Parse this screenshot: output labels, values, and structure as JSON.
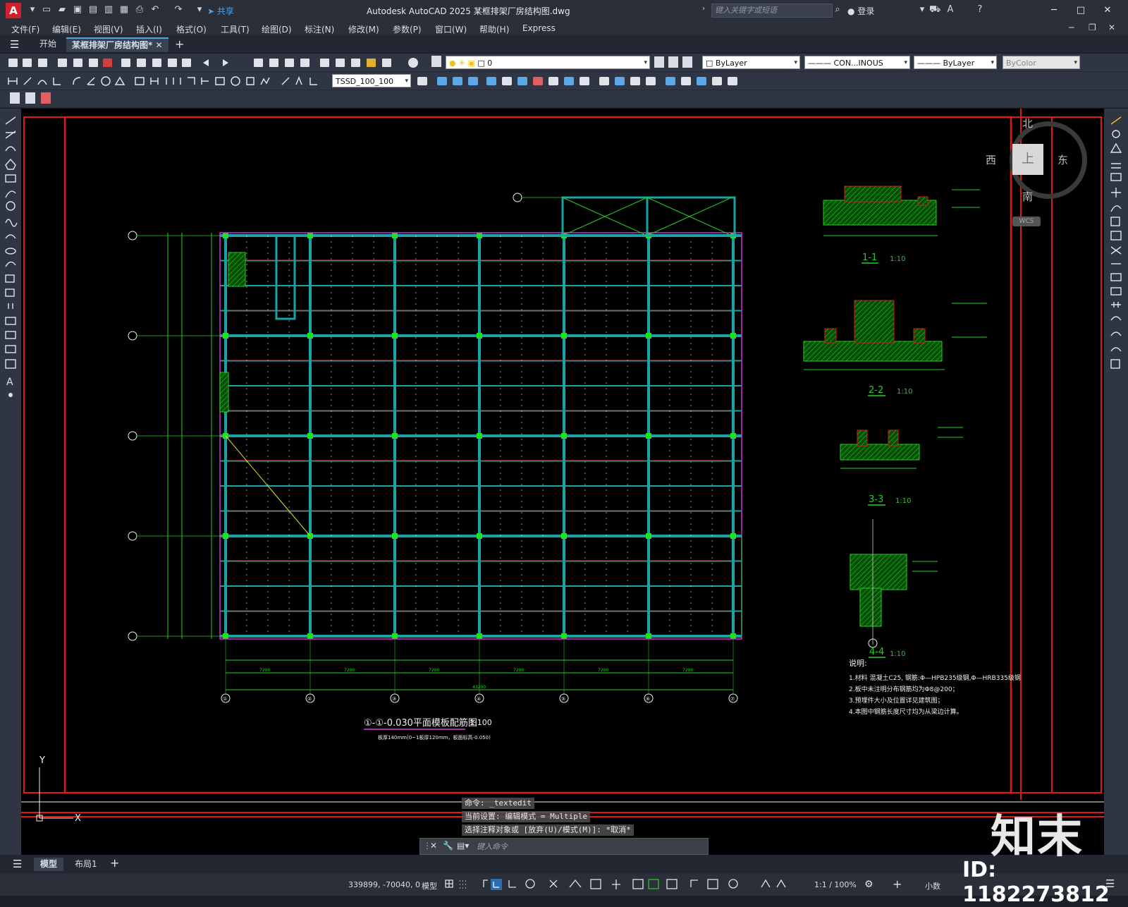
{
  "app": {
    "title": "Autodesk AutoCAD 2025    某框排架厂房结构图.dwg",
    "logo": "A",
    "share_label": "共享",
    "search_placeholder": "键入关键字或短语",
    "login_label": "登录"
  },
  "menu": [
    "文件(F)",
    "编辑(E)",
    "视图(V)",
    "插入(I)",
    "格式(O)",
    "工具(T)",
    "绘图(D)",
    "标注(N)",
    "修改(M)",
    "参数(P)",
    "窗口(W)",
    "帮助(H)",
    "Express"
  ],
  "tabs": {
    "start": "开始",
    "active": "某框排架厂房结构图*",
    "add": "+"
  },
  "properties": {
    "layer": "0",
    "color": "ByLayer",
    "linetype": "CON...INOUS",
    "lineweight": "ByLayer",
    "plotstyle": "ByColor",
    "dimstyle": "TSSD_100_100"
  },
  "viewcube": {
    "north": "北",
    "south": "南",
    "east": "东",
    "west": "西",
    "top": "上",
    "wcs": "WCS"
  },
  "drawing": {
    "plan_title": "①-①-0.030平面模板配筋图",
    "plan_scale": "1:100",
    "plan_subtitle": "板厚140mm(0~1板厚120mm，板面标高-0.050)",
    "total_dim": "43200",
    "bay_dims": [
      "7200",
      "7200",
      "7200",
      "7200",
      "7200",
      "7200"
    ],
    "grid_bottom": [
      "①",
      "②",
      "③",
      "④",
      "⑤",
      "⑥",
      "⑦"
    ],
    "sections": [
      {
        "label": "1-1",
        "scale": "1:10"
      },
      {
        "label": "2-2",
        "scale": "1:10"
      },
      {
        "label": "3-3",
        "scale": "1:10"
      },
      {
        "label": "4-4",
        "scale": "1:10"
      }
    ],
    "notes_title": "说明:",
    "notes": [
      "1.材料 混凝土C25, 钢筋:Φ—HPB235级钢,Φ—HRB335级钢",
      "2.板中未注明分布钢筋均为Φ8@200；",
      "3.预埋件大小及位置详见建筑图；",
      "4.本图中钢筋长度尺寸均为从梁边计算。"
    ],
    "ucs_x": "X",
    "ucs_y": "Y"
  },
  "command": {
    "lines": [
      "命令: _textedit",
      "当前设置: 编辑模式 = Multiple",
      "选择注释对象或 [放弃(U)/模式(M)]: *取消*"
    ],
    "placeholder": "键入命令"
  },
  "layout_tabs": [
    "模型",
    "布局1"
  ],
  "status": {
    "coords": "339899, -70040, 0",
    "space": "模型",
    "scale": "1:1 / 100%",
    "units": "小数"
  },
  "watermark": {
    "brand": "知末",
    "id": "ID: 1182273812"
  },
  "colors": {
    "accent": "#4fa3e0",
    "grid_line": "#1aa3a3",
    "beam": "#ff2020",
    "dim": "#20d020",
    "frame": "#e0181c",
    "bg": "#000000"
  }
}
